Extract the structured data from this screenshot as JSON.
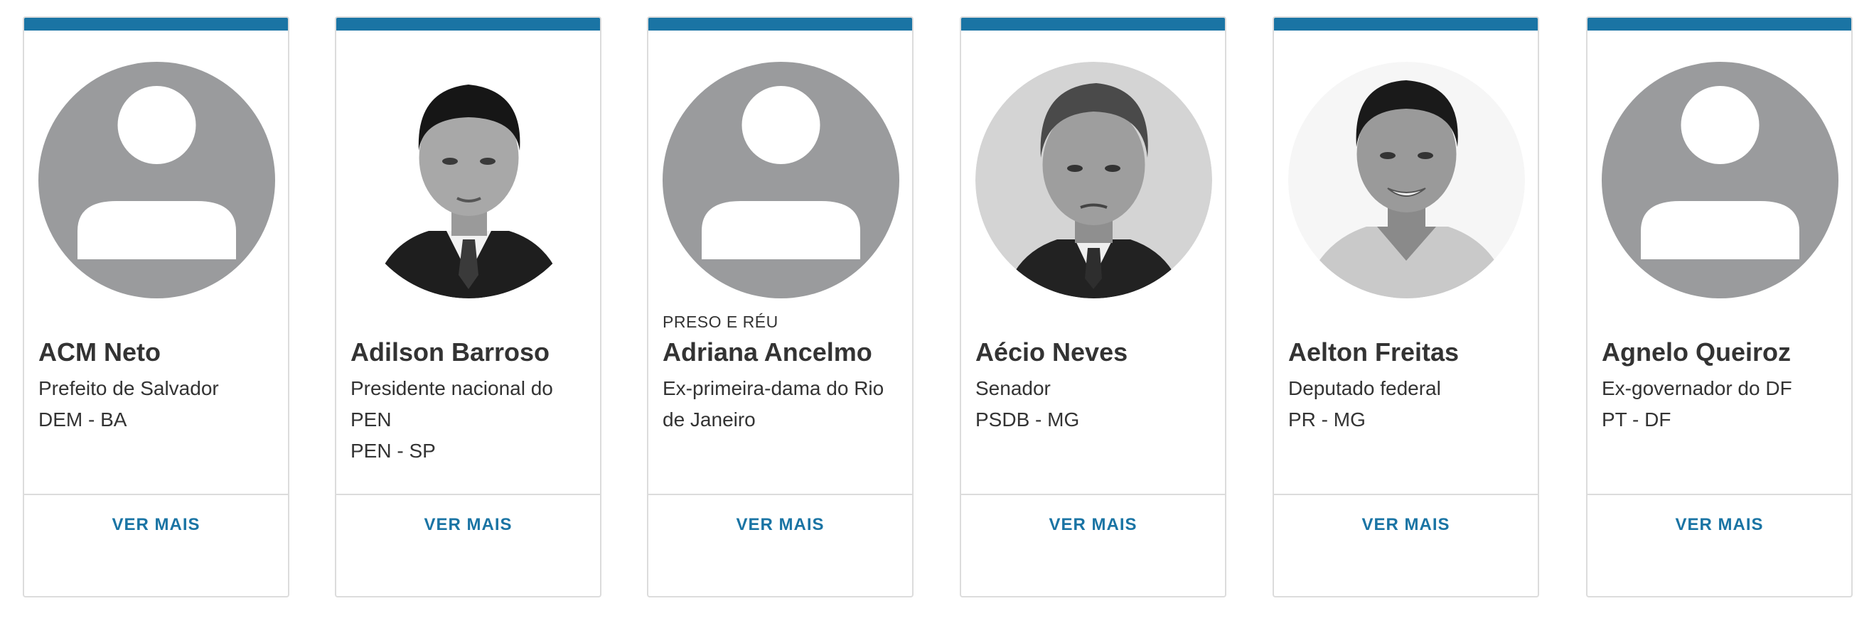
{
  "colors": {
    "accent": "#1a74a4",
    "placeholder": "#9a9b9d",
    "border": "#dcdcdc",
    "text": "#333333"
  },
  "cards": [
    {
      "tag": "",
      "name": "ACM Neto",
      "role": "Prefeito de Salvador",
      "party": "DEM - BA",
      "more": "VER MAIS",
      "photo": "placeholder-avatar-icon"
    },
    {
      "tag": "",
      "name": "Adilson Barroso",
      "role": "Presidente nacional do PEN",
      "party": "PEN - SP",
      "more": "VER MAIS",
      "photo": "portrait-photo"
    },
    {
      "tag": "PRESO E RÉU",
      "name": "Adriana Ancelmo",
      "role": "Ex-primeira-dama do Rio de Janeiro",
      "party": "",
      "more": "VER MAIS",
      "photo": "placeholder-avatar-icon"
    },
    {
      "tag": "",
      "name": "Aécio Neves",
      "role": "Senador",
      "party": "PSDB - MG",
      "more": "VER MAIS",
      "photo": "portrait-photo"
    },
    {
      "tag": "",
      "name": "Aelton Freitas",
      "role": "Deputado federal",
      "party": "PR - MG",
      "more": "VER MAIS",
      "photo": "portrait-photo"
    },
    {
      "tag": "",
      "name": "Agnelo Queiroz",
      "role": "Ex-governador do DF",
      "party": "PT - DF",
      "more": "VER MAIS",
      "photo": "placeholder-avatar-icon"
    }
  ]
}
